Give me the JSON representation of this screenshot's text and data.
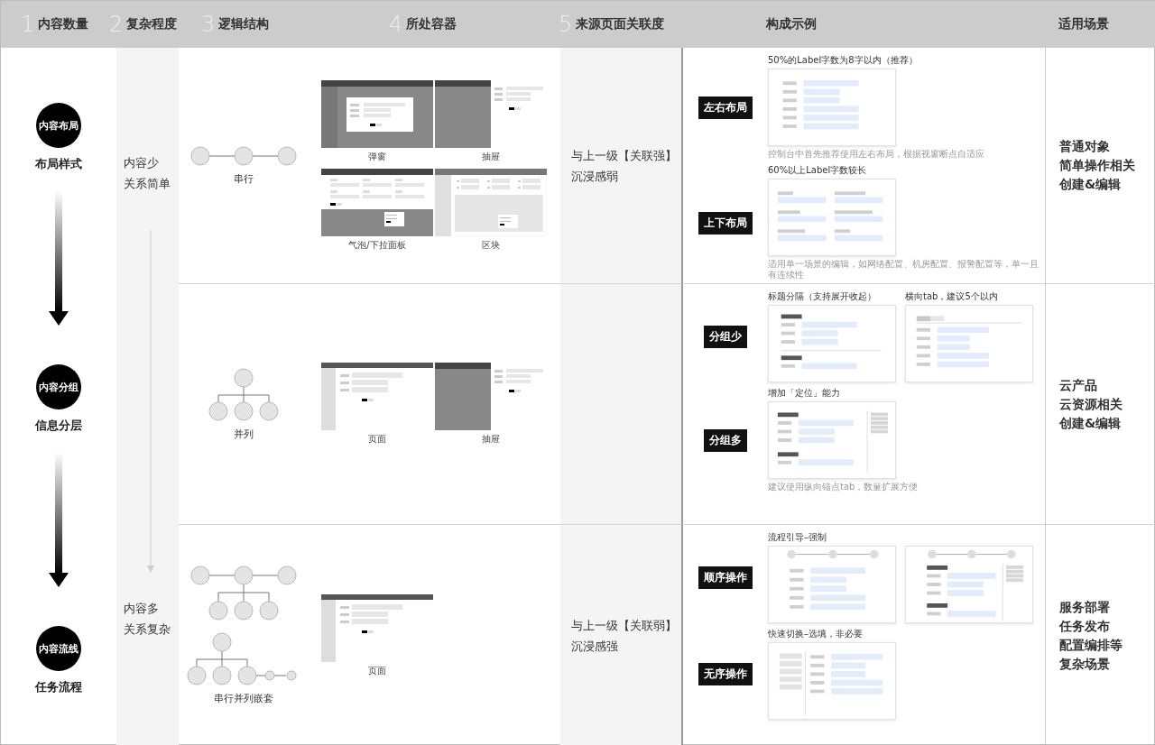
{
  "header": [
    {
      "number": "1",
      "label": "内容数量"
    },
    {
      "number": "2",
      "label": "复杂程度"
    },
    {
      "number": "3",
      "label": "逻辑结构"
    },
    {
      "number": "4",
      "label": "所处容器"
    },
    {
      "number": "5",
      "label": "来源页面关联度"
    },
    {
      "label": "构成示例"
    },
    {
      "label": "适用场景"
    }
  ],
  "flow": [
    {
      "badge": "内容布局",
      "caption": "布局样式"
    },
    {
      "badge": "内容分组",
      "caption": "信息分层"
    },
    {
      "badge": "内容流线",
      "caption": "任务流程"
    }
  ],
  "complexity": {
    "top": [
      "内容少",
      "关系简单"
    ],
    "bottom": [
      "内容多",
      "关系复杂"
    ]
  },
  "rows": [
    {
      "structures": [
        {
          "kind": "serial",
          "label": "串行"
        }
      ],
      "containers": [
        {
          "kind": "dialog",
          "label": "弹窗"
        },
        {
          "kind": "drawer",
          "label": "抽屉"
        },
        {
          "kind": "popover",
          "label": "气泡/下拉面板"
        },
        {
          "kind": "block",
          "label": "区块"
        }
      ],
      "relation": [
        "与上一级【关联强】",
        "沉浸感弱"
      ],
      "examples": [
        {
          "tag": "左右布局",
          "items": [
            {
              "title": "50%的Label字数为8字以内（推荐）",
              "kind": "horizontal-form",
              "note": "控制台中首先推荐使用左右布局，根据视窗断点自适应"
            }
          ]
        },
        {
          "tag": "上下布局",
          "items": [
            {
              "title": "60%以上Label字数较长",
              "kind": "vertical-form",
              "note": "适用单一场景的编辑，如网络配置、机房配置、报警配置等，单一且有连续性"
            }
          ]
        }
      ],
      "scenarios": [
        "普通对象",
        "简单操作相关",
        "创建&编辑"
      ]
    },
    {
      "structures": [
        {
          "kind": "parallel",
          "label": "并列"
        }
      ],
      "containers": [
        {
          "kind": "page",
          "label": "页面"
        },
        {
          "kind": "drawer",
          "label": "抽屉"
        }
      ],
      "examples": [
        {
          "tag": "分组少",
          "items": [
            {
              "title": "标题分隔（支持展开收起）",
              "kind": "grouped-form"
            },
            {
              "title": "横向tab，建议5个以内",
              "kind": "tabbed-form"
            }
          ]
        },
        {
          "tag": "分组多",
          "items": [
            {
              "title": "增加「定位」能力",
              "kind": "anchored-form",
              "note": "建议使用纵向锚点tab，数量扩展方便"
            }
          ]
        }
      ],
      "scenarios": [
        "云产品",
        "云资源相关",
        "创建&编辑"
      ]
    },
    {
      "structures": [
        {
          "kind": "serial-branch"
        },
        {
          "kind": "branch-serial",
          "label": "串行并列嵌套"
        }
      ],
      "containers": [
        {
          "kind": "page",
          "label": "页面"
        }
      ],
      "relation": [
        "与上一级【关联弱】",
        "沉浸感强"
      ],
      "examples": [
        {
          "tag": "顺序操作",
          "items": [
            {
              "title": "流程引导–强制",
              "kind": "steps-form"
            },
            {
              "kind": "steps-anchored-form"
            }
          ]
        },
        {
          "tag": "无序操作",
          "items": [
            {
              "title": "快速切换–选填，非必要",
              "kind": "side-nav-form"
            }
          ]
        }
      ],
      "scenarios": [
        "服务部署",
        "任务发布",
        "配置编排等",
        "复杂场景"
      ]
    }
  ]
}
